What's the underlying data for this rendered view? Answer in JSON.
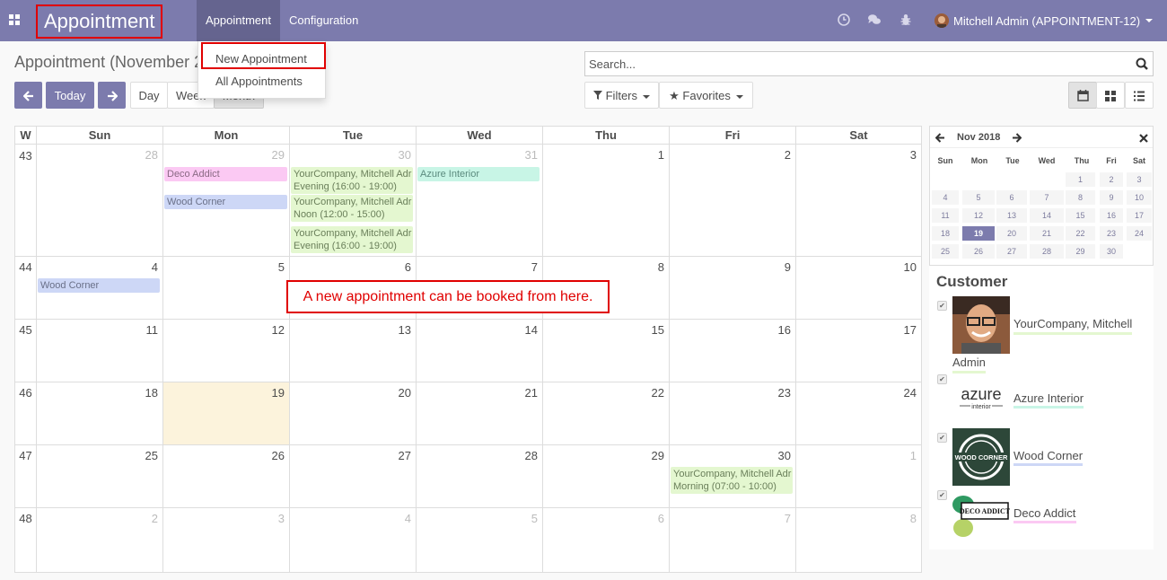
{
  "navbar": {
    "brand": "Appointment",
    "menus": [
      "Appointment",
      "Configuration"
    ],
    "user": "Mitchell Admin (APPOINTMENT-12)",
    "icons": [
      "clock-icon",
      "chat-icon",
      "bug-icon"
    ]
  },
  "dropdown": {
    "items": [
      "New Appointment",
      "All Appointments"
    ]
  },
  "control": {
    "title": "Appointment (November 2",
    "today": "Today",
    "views": [
      "Day",
      "Week",
      "Month"
    ],
    "search_placeholder": "Search...",
    "filters": "Filters",
    "favorites": "Favorites"
  },
  "calendar": {
    "week_header": "W",
    "weekdays": [
      "Sun",
      "Mon",
      "Tue",
      "Wed",
      "Thu",
      "Fri",
      "Sat"
    ],
    "weeks": [
      {
        "wk": "43",
        "days": [
          "28",
          "29",
          "30",
          "31",
          "1",
          "2",
          "3"
        ],
        "other": [
          true,
          true,
          true,
          true,
          false,
          false,
          false
        ]
      },
      {
        "wk": "44",
        "days": [
          "4",
          "5",
          "6",
          "7",
          "8",
          "9",
          "10"
        ],
        "other": [
          false,
          false,
          false,
          false,
          false,
          false,
          false
        ]
      },
      {
        "wk": "45",
        "days": [
          "11",
          "12",
          "13",
          "14",
          "15",
          "16",
          "17"
        ],
        "other": [
          false,
          false,
          false,
          false,
          false,
          false,
          false
        ]
      },
      {
        "wk": "46",
        "days": [
          "18",
          "19",
          "20",
          "21",
          "22",
          "23",
          "24"
        ],
        "other": [
          false,
          false,
          false,
          false,
          false,
          false,
          false
        ]
      },
      {
        "wk": "47",
        "days": [
          "25",
          "26",
          "27",
          "28",
          "29",
          "30",
          "1"
        ],
        "other": [
          false,
          false,
          false,
          false,
          false,
          false,
          true
        ]
      },
      {
        "wk": "48",
        "days": [
          "2",
          "3",
          "4",
          "5",
          "6",
          "7",
          "8"
        ],
        "other": [
          true,
          true,
          true,
          true,
          true,
          true,
          true
        ]
      }
    ],
    "events": {
      "deco_addict": "Deco Addict",
      "wood_corner_1": "Wood Corner",
      "tue_1_l1": "YourCompany, Mitchell Adr",
      "tue_1_l2": "Evening (16:00 - 19:00)",
      "tue_2_l1": "YourCompany, Mitchell Adr",
      "tue_2_l2": "Noon (12:00 - 15:00)",
      "tue_3_l1": "YourCompany, Mitchell Adr",
      "tue_3_l2": "Evening (16:00 - 19:00)",
      "azure": "Azure Interior",
      "wood_corner_2": "Wood Corner",
      "fri_l1": "YourCompany, Mitchell Adr",
      "fri_l2": "Morning (07:00 - 10:00)"
    },
    "annotation": "A new appointment can be booked from here."
  },
  "mini_calendar": {
    "title": "Nov 2018",
    "weekdays": [
      "Sun",
      "Mon",
      "Tue",
      "Wed",
      "Thu",
      "Fri",
      "Sat"
    ],
    "rows": [
      [
        "",
        "",
        "",
        "",
        "1",
        "2",
        "3"
      ],
      [
        "4",
        "5",
        "6",
        "7",
        "8",
        "9",
        "10"
      ],
      [
        "11",
        "12",
        "13",
        "14",
        "15",
        "16",
        "17"
      ],
      [
        "18",
        "19",
        "20",
        "21",
        "22",
        "23",
        "24"
      ],
      [
        "25",
        "26",
        "27",
        "28",
        "29",
        "30",
        ""
      ]
    ],
    "selected": "19"
  },
  "customers": {
    "title": "Customer",
    "items": [
      {
        "name1": "YourCompany, Mitchell",
        "name2": "Admin",
        "color": "#e4f7d0"
      },
      {
        "name1": "Azure Interior",
        "color": "#c8f5e6"
      },
      {
        "name1": "Wood Corner",
        "color": "#cdd7f6"
      },
      {
        "name1": "Deco Addict",
        "color": "#fbc9f3"
      }
    ],
    "logo_text": {
      "azure": "azure",
      "azure_sub": "interior",
      "wood": "WOOD CORNER",
      "deco": "DECO ADDICT"
    }
  }
}
